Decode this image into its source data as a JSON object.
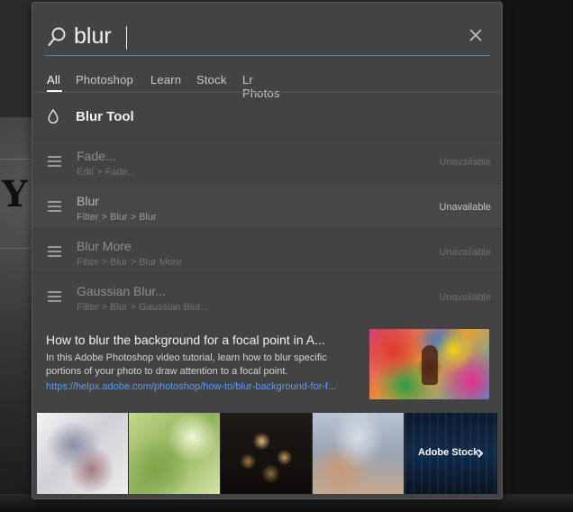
{
  "search": {
    "value": "blur"
  },
  "tabs": [
    {
      "label": "All",
      "active": true
    },
    {
      "label": "Photoshop"
    },
    {
      "label": "Learn"
    },
    {
      "label": "Stock"
    },
    {
      "label": "Lr Photos"
    }
  ],
  "tool_result": {
    "label": "Blur Tool",
    "icon": "droplet-icon"
  },
  "menu_results": [
    {
      "title": "Fade...",
      "path": "Edit > Fade...",
      "status": "Unavailable",
      "enabled": false
    },
    {
      "title": "Blur",
      "path": "Filter > Blur > Blur",
      "status": "Unavailable",
      "enabled": true
    },
    {
      "title": "Blur More",
      "path": "Filter > Blur > Blur More",
      "status": "Unavailable",
      "enabled": false
    },
    {
      "title": "Gaussian Blur...",
      "path": "Filter > Blur > Gaussian Blur...",
      "status": "Unavailable",
      "enabled": false
    }
  ],
  "learn_result": {
    "title": "How to blur the background for a focal point in A...",
    "description": "In this Adobe Photoshop video tutorial, learn how to blur specific portions of your photo to draw attention to a focal point.",
    "link": "https://helpx.adobe.com/photoshop/how-to/blur-background-for-f..."
  },
  "stock": {
    "label": "Adobe Stock"
  },
  "colors": {
    "panel": "#434343",
    "accent_link": "#5b9cf0",
    "search_underline": "#5a84c4"
  }
}
